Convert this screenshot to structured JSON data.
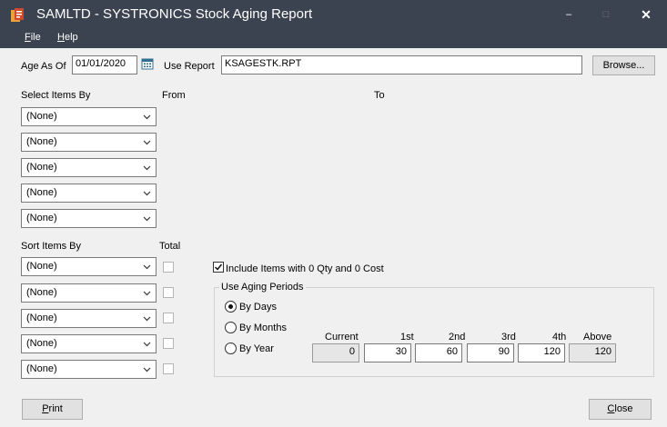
{
  "window": {
    "title": "SAMLTD - SYSTRONICS Stock Aging Report",
    "minimize_glyph": "–",
    "maximize_glyph": "□",
    "close_glyph": "✕"
  },
  "menu": {
    "file_u": "F",
    "file_rest": "ile",
    "help_u": "H",
    "help_rest": "elp"
  },
  "form": {
    "age_as_of_label": "Age As Of",
    "age_as_of_value": "01/01/2020",
    "use_report_label": "Use Report",
    "use_report_value": "KSAGESTK.RPT",
    "browse_label": "Browse...",
    "select_items_by_label": "Select Items By",
    "from_label": "From",
    "to_label": "To",
    "select_items": [
      "(None)",
      "(None)",
      "(None)",
      "(None)",
      "(None)"
    ],
    "sort_items_by_label": "Sort Items By",
    "total_label": "Total",
    "sort_items": [
      "(None)",
      "(None)",
      "(None)",
      "(None)",
      "(None)"
    ],
    "include_zero_label": "Include Items with 0 Qty and 0 Cost",
    "include_zero_checked": true
  },
  "aging": {
    "group_label": "Use Aging Periods",
    "by_days": "By Days",
    "by_months": "By Months",
    "by_year": "By Year",
    "selected": "By Days",
    "columns": [
      "Current",
      "1st",
      "2nd",
      "3rd",
      "4th",
      "Above"
    ],
    "values": [
      "0",
      "30",
      "60",
      "90",
      "120",
      "120"
    ]
  },
  "buttons": {
    "print_u": "P",
    "print_rest": "rint",
    "close_u": "C",
    "close_rest": "lose"
  },
  "icons": {
    "app": "app-report-icon",
    "calendar": "calendar-icon",
    "dropdown": "chevron-down-icon",
    "checkmark": "checkmark-icon"
  }
}
